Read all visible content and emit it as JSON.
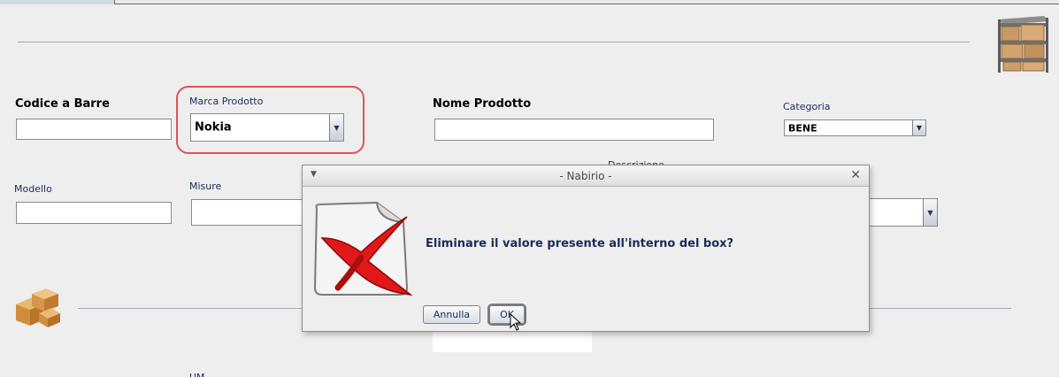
{
  "form": {
    "barcode_label": "Codice a Barre",
    "brand_label": "Marca Prodotto",
    "brand_value": "Nokia",
    "product_name_label": "Nome Prodotto",
    "category_label": "Categoria",
    "category_value": "BENE",
    "model_label": "Modello",
    "size_label": "Misure",
    "description_label": "Descrizione",
    "um_label": "UM"
  },
  "dialog": {
    "title": "- Nabirio -",
    "message": "Eliminare il valore presente all'interno del box?",
    "cancel_label": "Annulla",
    "ok_label": "OK"
  },
  "icons": {
    "top_right": "boxes-shelf-icon",
    "left": "packages-icon",
    "dialog": "delete-document-icon"
  }
}
